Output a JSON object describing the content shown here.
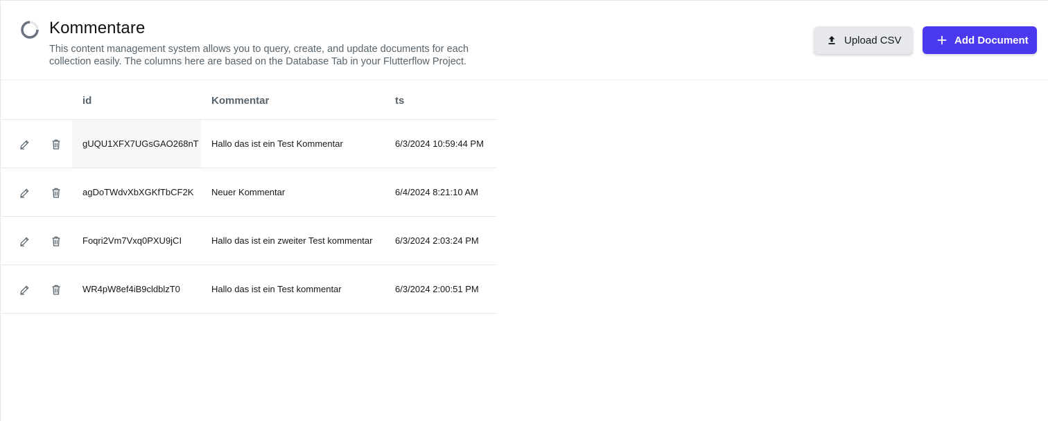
{
  "header": {
    "title": "Kommentare",
    "subtitle": "This content management system allows you to query, create, and update documents for each collection easily. The columns here are based on the Database Tab in your Flutterflow Project.",
    "title_icon": "spinner-ring-icon"
  },
  "actions": {
    "upload_label": "Upload CSV",
    "upload_icon": "upload-icon",
    "add_label": "Add Document",
    "add_icon": "plus-icon"
  },
  "colors": {
    "accent": "#4b39ef",
    "secondary_button": "#e6e8ec",
    "muted_text": "#57636c"
  },
  "table": {
    "columns": [
      "id",
      "Kommentar",
      "ts"
    ],
    "rows": [
      {
        "id": "gUQU1XFX7UGsGAO268nT",
        "kommentar": "Hallo das ist ein Test Kommentar",
        "ts": "6/3/2024 10:59:44 PM"
      },
      {
        "id": "agDoTWdvXbXGKfTbCF2K",
        "kommentar": "Neuer Kommentar",
        "ts": "6/4/2024 8:21:10 AM"
      },
      {
        "id": "Foqri2Vm7Vxq0PXU9jCI",
        "kommentar": "Hallo das ist ein zweiter Test kommentar",
        "ts": "6/3/2024 2:03:24 PM"
      },
      {
        "id": "WR4pW8ef4iB9cldblzT0",
        "kommentar": "Hallo das ist ein Test kommentar",
        "ts": "6/3/2024 2:00:51 PM"
      }
    ],
    "row_icons": [
      "edit-icon",
      "trash-icon"
    ]
  }
}
